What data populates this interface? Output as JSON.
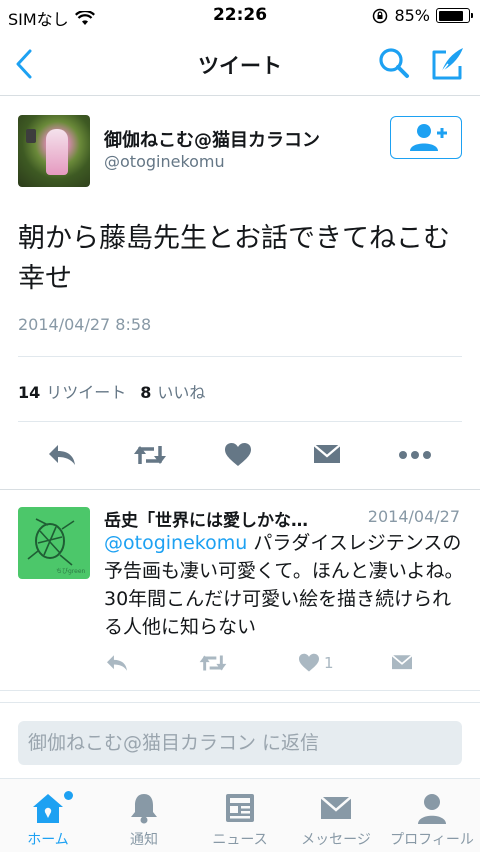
{
  "status_bar": {
    "carrier": "SIMなし",
    "time": "22:26",
    "battery_text": "85%",
    "battery_level": 0.85
  },
  "nav": {
    "title": "ツイート",
    "back_icon": "chevron-left-icon",
    "search_icon": "search-icon",
    "compose_icon": "compose-icon"
  },
  "tweet": {
    "author_name": "御伽ねこむ@猫目カラコン",
    "author_handle": "@otoginekomu",
    "text": "朝から藤島先生とお話できてねこむ幸せ",
    "timestamp": "2014/04/27 8:58",
    "retweet_count": "14",
    "retweet_label": "リツイート",
    "like_count": "8",
    "like_label": "いいね"
  },
  "reply": {
    "author_name": "岳史「世界には愛しかな…",
    "date": "2014/04/27",
    "mention": "@otoginekomu",
    "text": " パラダイスレジテンスの予告画も凄い可愛くて。ほんと凄いよね。30年間こんだけ可愛い絵を描き続けられる人他に知らない",
    "like_count": "1"
  },
  "composer": {
    "placeholder": "御伽ねこむ@猫目カラコン に返信"
  },
  "tabs": [
    {
      "label": "ホーム",
      "icon": "home-icon"
    },
    {
      "label": "通知",
      "icon": "bell-icon"
    },
    {
      "label": "ニュース",
      "icon": "news-icon"
    },
    {
      "label": "メッセージ",
      "icon": "envelope-icon"
    },
    {
      "label": "プロフィール",
      "icon": "person-icon"
    }
  ],
  "colors": {
    "accent": "#1da1f2",
    "icon_gray": "#657786",
    "light_gray": "#aab8c2"
  }
}
